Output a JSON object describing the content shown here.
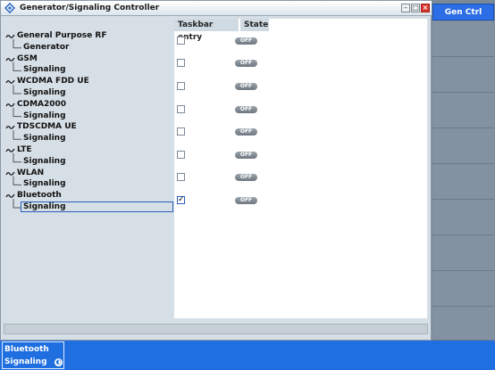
{
  "window": {
    "title": "Generator/Signaling Controller"
  },
  "table": {
    "headers": [
      "Taskbar entry",
      "State"
    ],
    "rows": [
      {
        "group": "General Purpose RF",
        "child": "Generator",
        "checked": false,
        "state": "OFF"
      },
      {
        "group": "GSM",
        "child": "Signaling",
        "checked": false,
        "state": "OFF"
      },
      {
        "group": "WCDMA FDD UE",
        "child": "Signaling",
        "checked": false,
        "state": "OFF"
      },
      {
        "group": "CDMA2000",
        "child": "Signaling",
        "checked": false,
        "state": "OFF"
      },
      {
        "group": "TDSCDMA UE",
        "child": "Signaling",
        "checked": false,
        "state": "OFF"
      },
      {
        "group": "LTE",
        "child": "Signaling",
        "checked": false,
        "state": "OFF"
      },
      {
        "group": "WLAN",
        "child": "Signaling",
        "checked": false,
        "state": "OFF"
      },
      {
        "group": "Bluetooth",
        "child": "Signaling",
        "checked": true,
        "state": "OFF"
      }
    ]
  },
  "sidebar": {
    "active_label": "Gen Ctrl"
  },
  "taskbar": {
    "item_line1": "Bluetooth",
    "item_line2": "Signaling"
  },
  "colors": {
    "accent": "#1f6fe0",
    "sidebar": "#7a8a99",
    "tree_bg": "#d6dfe6"
  }
}
